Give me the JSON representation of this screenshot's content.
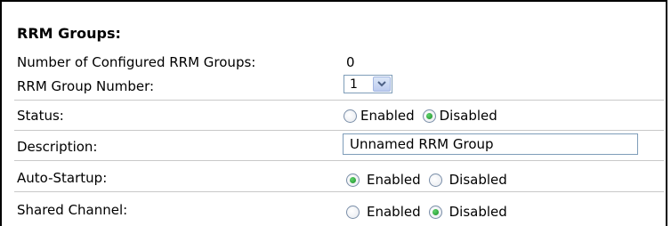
{
  "section": {
    "title": "RRM Groups:"
  },
  "fields": {
    "num_groups": {
      "label": "Number of Configured RRM Groups:",
      "value": "0"
    },
    "group_number": {
      "label": "RRM Group Number:",
      "selected": "1"
    },
    "status": {
      "label": "Status:",
      "option_enabled": "Enabled",
      "option_disabled": "Disabled",
      "selected": "Disabled"
    },
    "description": {
      "label": "Description:",
      "value": "Unnamed RRM Group"
    },
    "auto_startup": {
      "label": "Auto-Startup:",
      "option_enabled": "Enabled",
      "option_disabled": "Disabled",
      "selected": "Enabled"
    },
    "shared_channel": {
      "label": "Shared Channel:",
      "option_enabled": "Enabled",
      "option_disabled": "Disabled",
      "selected": "Disabled"
    }
  },
  "colors": {
    "radio_selected": "#1a8f2a",
    "input_border": "#7f9db9",
    "row_separator": "#c9c9c9"
  }
}
